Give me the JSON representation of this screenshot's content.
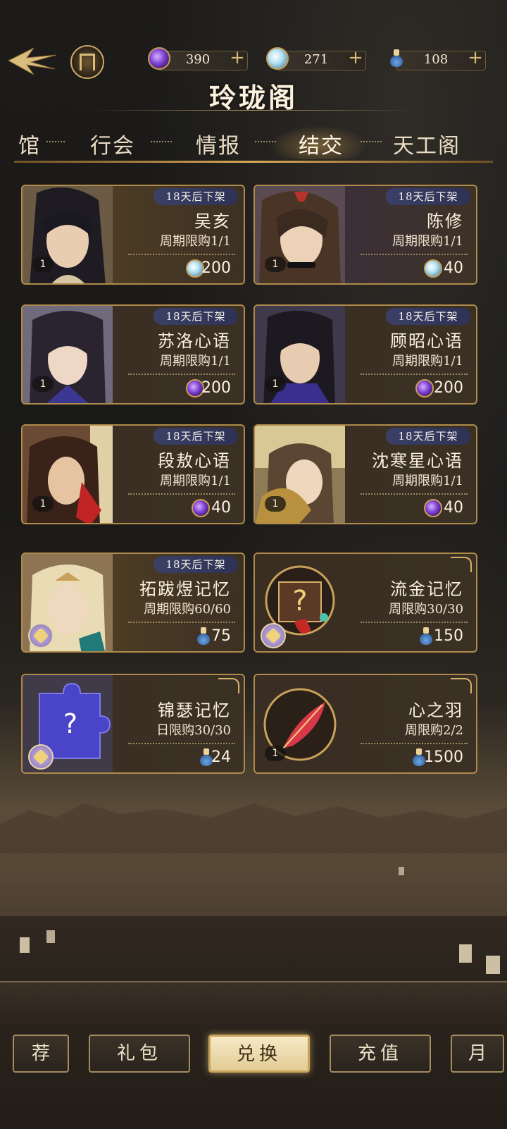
{
  "header": {
    "title": "玲珑阁",
    "currencies": [
      {
        "icon": "purple-gem-icon",
        "value": "390"
      },
      {
        "icon": "blue-gem-icon",
        "value": "271"
      },
      {
        "icon": "bottle-icon",
        "value": "108"
      }
    ]
  },
  "tabs": [
    {
      "label": "馆"
    },
    {
      "label": "行会"
    },
    {
      "label": "情报"
    },
    {
      "label": "结交",
      "active": true
    },
    {
      "label": "天工阁"
    }
  ],
  "cards": [
    {
      "name": "吴亥",
      "expire": "18天后下架",
      "limit": "周期限购1/1",
      "price": "200",
      "currency": "blue-gem",
      "qty": "1"
    },
    {
      "name": "陈修",
      "expire": "18天后下架",
      "limit": "周期限购1/1",
      "price": "40",
      "currency": "blue-gem",
      "qty": "1"
    },
    {
      "name": "苏洛心语",
      "expire": "18天后下架",
      "limit": "周期限购1/1",
      "price": "200",
      "currency": "purple-gem",
      "qty": "1"
    },
    {
      "name": "顾昭心语",
      "expire": "18天后下架",
      "limit": "周期限购1/1",
      "price": "200",
      "currency": "purple-gem",
      "qty": "1"
    },
    {
      "name": "段敖心语",
      "expire": "18天后下架",
      "limit": "周期限购1/1",
      "price": "40",
      "currency": "purple-gem",
      "qty": "1"
    },
    {
      "name": "沈寒星心语",
      "expire": "18天后下架",
      "limit": "周期限购1/1",
      "price": "40",
      "currency": "purple-gem",
      "qty": "1"
    },
    {
      "name": "拓跋煜记忆",
      "expire": "18天后下架",
      "limit": "周期限购60/60",
      "price": "75",
      "currency": "bottle"
    },
    {
      "name": "流金记忆",
      "limit": "周限购30/30",
      "price": "150",
      "currency": "bottle"
    },
    {
      "name": "锦瑟记忆",
      "limit": "日限购30/30",
      "price": "24",
      "currency": "bottle"
    },
    {
      "name": "心之羽",
      "limit": "周限购2/2",
      "price": "1500",
      "currency": "bottle",
      "qty": "1"
    }
  ],
  "bottom_nav": [
    {
      "label": "荐"
    },
    {
      "label": "礼包"
    },
    {
      "label": "兑换",
      "active": true
    },
    {
      "label": "充值"
    },
    {
      "label": "月"
    }
  ],
  "colors": {
    "accent_gold": "#c9a25a",
    "expire_badge": "#3a4066",
    "purple_gem": "#7c3fd1",
    "blue_gem": "#b5e1f2"
  }
}
